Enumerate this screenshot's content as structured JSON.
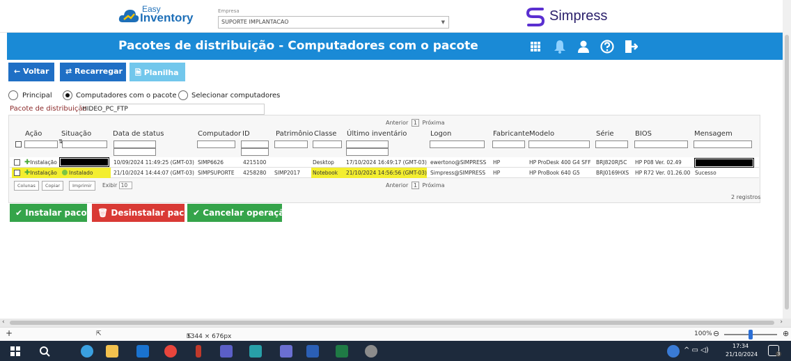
{
  "header": {
    "logo_line1": "Easy",
    "logo_line2": "Inventory",
    "empresa_label": "Empresa",
    "empresa_value": "SUPORTE IMPLANTACAO",
    "simpress_logo": "Simpress"
  },
  "titlebar": {
    "title": "Pacotes de distribuição - Computadores com o pacote",
    "icons": [
      "grid-icon",
      "bell-icon",
      "user-icon",
      "help-icon",
      "logout-icon"
    ]
  },
  "toolbar": {
    "back": "← Voltar",
    "reload": "⇄ Recarregar",
    "sheet": "Planilha"
  },
  "views": {
    "principal": "Principal",
    "computers": "Computadores com o pacote",
    "select": "Selecionar computadores",
    "selected": "computers"
  },
  "package": {
    "label": "Pacote de distribuição",
    "value": "HIDEO_PC_FTP"
  },
  "pager": {
    "prev": "Anterior",
    "page": "1",
    "next": "Próxima"
  },
  "table": {
    "columns": [
      "Ação",
      "Situação",
      "Data de status",
      "Computador",
      "ID",
      "Patrimônio",
      "Classe",
      "Último inventário",
      "Logon",
      "Fabricante",
      "Modelo",
      "Série",
      "BIOS",
      "Mensagem"
    ],
    "rows": [
      {
        "acao": "Instalação",
        "situacao": "",
        "data_status": "10/09/2024 11:49:25 (GMT-03)",
        "computador": "SIMP6626",
        "id": "4215100",
        "patrimonio": "",
        "classe": "Desktop",
        "ultimo_inventario": "17/10/2024 16:49:17 (GMT-03)",
        "logon": "ewertono@SIMPRESS",
        "fabricante": "HP",
        "modelo": "HP ProDesk 400 G4 SFF",
        "serie": "BRJ820RJ5C",
        "bios": "HP P08 Ver. 02.49",
        "mensagem": ""
      },
      {
        "acao": "Instalação",
        "situacao": "Instalado",
        "data_status": "21/10/2024 14:44:07 (GMT-03)",
        "computador": "SIMPSUPORTE",
        "id": "4258280",
        "patrimonio": "SIMP2017",
        "classe": "Notebook",
        "ultimo_inventario": "21/10/2024 14:56:56 (GMT-03)",
        "logon": "Simpress@SIMPRESS",
        "fabricante": "HP",
        "modelo": "HP ProBook 640 G5",
        "serie": "BRJ0169HXS",
        "bios": "HP R72 Ver. 01.26.00",
        "mensagem": "Sucesso"
      }
    ]
  },
  "table_tools": {
    "columns_btn": "Colunas",
    "copy_btn": "Copiar",
    "print_btn": "Imprimir",
    "show_label": "Exibir",
    "show_value": "10",
    "records": "2 registros"
  },
  "actions": {
    "install": "✔ Instalar pacote",
    "uninstall": "Desinstalar pacote",
    "cancel": "✔ Cancelar operação"
  },
  "statusbar": {
    "dimensions": "1344 × 676px",
    "zoom": "100%"
  },
  "taskbar": {
    "time": "17:34",
    "date": "21/10/2024",
    "notif_count": "3"
  },
  "colors": {
    "title_blue": "#1a8ad6",
    "btn_blue": "#1f6fc5",
    "green": "#35a44a",
    "red": "#d93a35",
    "highlight": "#f3ee2f"
  }
}
